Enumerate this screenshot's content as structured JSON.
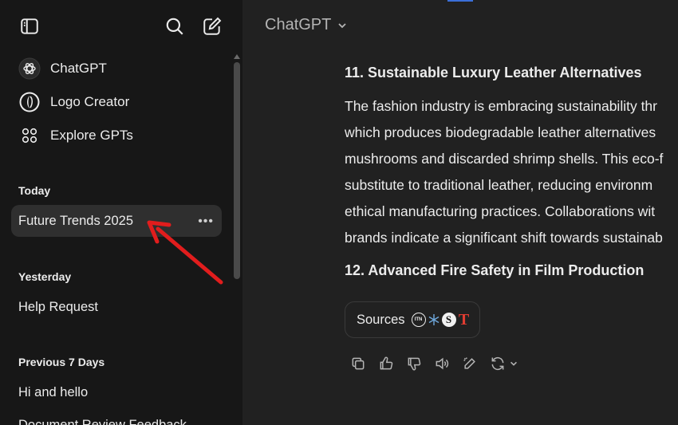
{
  "sidebar": {
    "nav": [
      {
        "label": "ChatGPT",
        "icon": "chatgpt-logo-icon"
      },
      {
        "label": "Logo Creator",
        "icon": "logo-creator-icon"
      },
      {
        "label": "Explore GPTs",
        "icon": "grid-dots-icon"
      }
    ],
    "sections": [
      {
        "title": "Today",
        "items": [
          "Future Trends 2025"
        ]
      },
      {
        "title": "Yesterday",
        "items": [
          "Help Request"
        ]
      },
      {
        "title": "Previous 7 Days",
        "items": [
          "Hi and hello",
          "Document Review Feedback"
        ]
      }
    ]
  },
  "header": {
    "model": "ChatGPT"
  },
  "message": {
    "heading_11": "11. Sustainable Luxury Leather Alternatives",
    "paragraph_lines": [
      "The fashion industry is embracing sustainability thr",
      "which produces biodegradable leather alternatives",
      "mushrooms and discarded shrimp shells. This eco-f",
      "substitute to traditional leather, reducing environm",
      "ethical manufacturing practices. Collaborations wit",
      "brands indicate a significant shift towards sustainab"
    ],
    "heading_12": "12. Advanced Fire Safety in Film Production",
    "sources_label": "Sources",
    "source_favicons": [
      "ITN",
      "S",
      "T"
    ]
  },
  "colors": {
    "sidebar_bg": "#171717",
    "main_bg": "#212121",
    "active_item_bg": "#2f2f2f",
    "annotation_arrow": "#e11d1d"
  }
}
